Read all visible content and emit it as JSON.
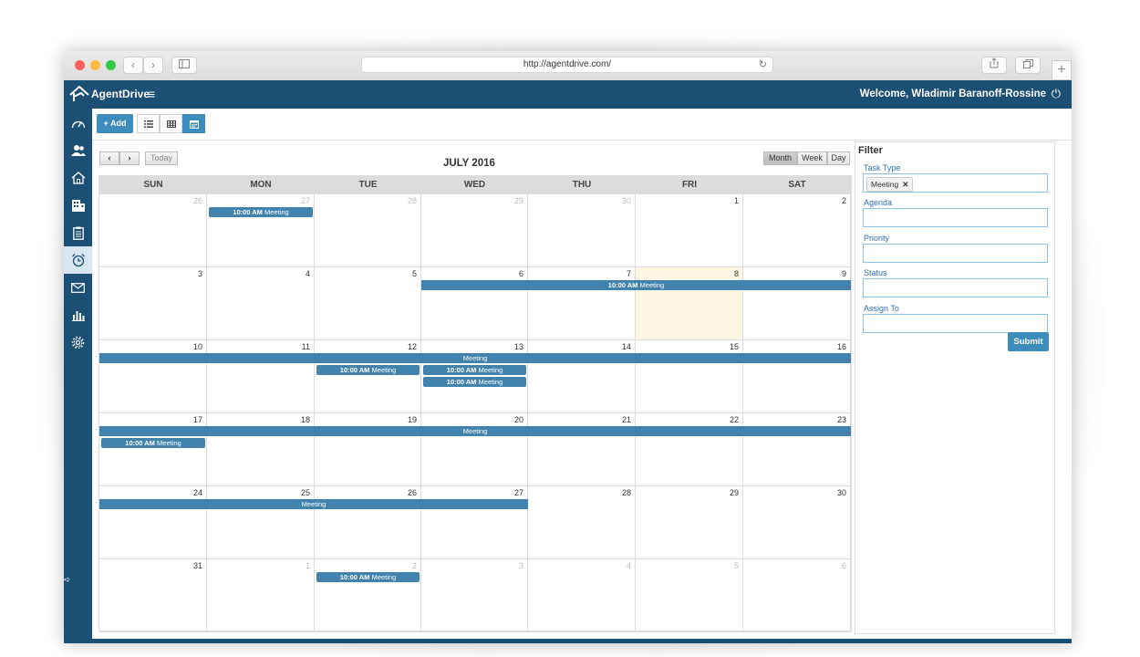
{
  "browser": {
    "url": "http://agentdrive.com/"
  },
  "header": {
    "brand": "AgentDrive",
    "welcome": "Welcome, Wladimir Baranoff-Rossine"
  },
  "sidebar": {
    "icons": [
      "dashboard-icon",
      "users-icon",
      "home-icon",
      "building-icon",
      "clipboard-icon",
      "alarm-clock-icon",
      "mail-icon",
      "bar-chart-icon",
      "gear-icon"
    ],
    "active_index": 5
  },
  "toolbar": {
    "add_label": "+ Add"
  },
  "calendar": {
    "today_label": "Today",
    "month_title": "JULY 2016",
    "view_buttons": [
      "Month",
      "Week",
      "Day"
    ],
    "active_view": "Month",
    "day_names": [
      "SUN",
      "MON",
      "TUE",
      "WED",
      "THU",
      "FRI",
      "SAT"
    ],
    "weeks": [
      [
        {
          "d": "26",
          "o": true
        },
        {
          "d": "27",
          "o": true
        },
        {
          "d": "28",
          "o": true
        },
        {
          "d": "29",
          "o": true
        },
        {
          "d": "30",
          "o": true
        },
        {
          "d": "1",
          "o": false
        },
        {
          "d": "2",
          "o": false
        }
      ],
      [
        {
          "d": "3",
          "o": false
        },
        {
          "d": "4",
          "o": false
        },
        {
          "d": "5",
          "o": false
        },
        {
          "d": "6",
          "o": false
        },
        {
          "d": "7",
          "o": false
        },
        {
          "d": "8",
          "o": false,
          "today": true
        },
        {
          "d": "9",
          "o": false
        }
      ],
      [
        {
          "d": "10",
          "o": false
        },
        {
          "d": "11",
          "o": false
        },
        {
          "d": "12",
          "o": false
        },
        {
          "d": "13",
          "o": false
        },
        {
          "d": "14",
          "o": false
        },
        {
          "d": "15",
          "o": false
        },
        {
          "d": "16",
          "o": false
        }
      ],
      [
        {
          "d": "17",
          "o": false
        },
        {
          "d": "18",
          "o": false
        },
        {
          "d": "19",
          "o": false
        },
        {
          "d": "20",
          "o": false
        },
        {
          "d": "21",
          "o": false
        },
        {
          "d": "22",
          "o": false
        },
        {
          "d": "23",
          "o": false
        }
      ],
      [
        {
          "d": "24",
          "o": false
        },
        {
          "d": "25",
          "o": false
        },
        {
          "d": "26",
          "o": false
        },
        {
          "d": "27",
          "o": false
        },
        {
          "d": "28",
          "o": false
        },
        {
          "d": "29",
          "o": false
        },
        {
          "d": "30",
          "o": false
        }
      ],
      [
        {
          "d": "31",
          "o": false
        },
        {
          "d": "1",
          "o": true
        },
        {
          "d": "2",
          "o": true
        },
        {
          "d": "3",
          "o": true
        },
        {
          "d": "4",
          "o": true
        },
        {
          "d": "5",
          "o": true
        },
        {
          "d": "6",
          "o": true
        }
      ]
    ],
    "events": [
      {
        "week": 0,
        "startDay": 1,
        "span": 1,
        "slot": 0,
        "time": "10:00 AM",
        "title": "Meeting"
      },
      {
        "week": 1,
        "startDay": 3,
        "span": 4,
        "slot": 0,
        "time": "10:00 AM",
        "title": "Meeting"
      },
      {
        "week": 2,
        "startDay": 0,
        "span": 7,
        "slot": 0,
        "time": "",
        "title": "Meeting"
      },
      {
        "week": 2,
        "startDay": 2,
        "span": 1,
        "slot": 1,
        "time": "10:00 AM",
        "title": "Meeting"
      },
      {
        "week": 2,
        "startDay": 3,
        "span": 1,
        "slot": 1,
        "time": "10:00 AM",
        "title": "Meeting"
      },
      {
        "week": 2,
        "startDay": 3,
        "span": 1,
        "slot": 2,
        "time": "10:00 AM",
        "title": "Meeting"
      },
      {
        "week": 3,
        "startDay": 0,
        "span": 7,
        "slot": 0,
        "time": "",
        "title": "Meeting"
      },
      {
        "week": 3,
        "startDay": 0,
        "span": 1,
        "slot": 1,
        "time": "10:00 AM",
        "title": "Meeting"
      },
      {
        "week": 4,
        "startDay": 0,
        "span": 4,
        "slot": 0,
        "time": "",
        "title": "Meeting"
      },
      {
        "week": 5,
        "startDay": 2,
        "span": 1,
        "slot": 0,
        "time": "10:00 AM",
        "title": "Meeting"
      }
    ]
  },
  "filter": {
    "title": "Filter",
    "task_type_label": "Task Type",
    "task_type_tag": "Meeting",
    "agenda_label": "Agenda",
    "priority_label": "Priority",
    "status_label": "Status",
    "assign_to_label": "Assign To",
    "submit_label": "Submit"
  }
}
